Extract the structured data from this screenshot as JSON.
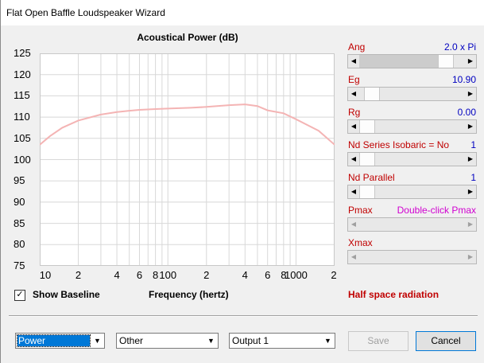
{
  "window": {
    "title": "Flat Open Baffle Loudspeaker Wizard"
  },
  "chart_data": {
    "type": "line",
    "title": "Acoustical Power (dB)",
    "xlabel": "Frequency (hertz)",
    "ylabel": "",
    "x_scale": "log",
    "xlim": [
      10,
      2000
    ],
    "ylim": [
      75,
      125
    ],
    "y_ticks": [
      "125",
      "120",
      "115",
      "110",
      "105",
      "100",
      "95",
      "90",
      "85",
      "80",
      "75"
    ],
    "x_ticks": [
      "10",
      "2",
      "4",
      "6",
      "8",
      "100",
      "2",
      "4",
      "6",
      "8",
      "1000",
      "2"
    ],
    "grid": true,
    "line_color": "#f4b4b4",
    "series": [
      {
        "x": [
          10,
          12,
          15,
          20,
          30,
          40,
          50,
          60,
          80,
          100,
          150,
          200,
          300,
          400,
          500,
          600,
          800,
          1000,
          1500,
          2000
        ],
        "y": [
          103.5,
          105.5,
          107.5,
          109.2,
          110.6,
          111.2,
          111.5,
          111.7,
          111.9,
          112.0,
          112.2,
          112.4,
          112.8,
          113.0,
          112.6,
          111.6,
          110.9,
          109.5,
          106.8,
          103.5
        ]
      }
    ]
  },
  "params": [
    {
      "label": "Ang",
      "value": "2.0 x Pi",
      "level": 0.88,
      "enabled": true
    },
    {
      "label": "Eg",
      "value": "10.90",
      "level": 0.05,
      "enabled": true
    },
    {
      "label": "Rg",
      "value": "0.00",
      "level": 0.0,
      "enabled": true
    },
    {
      "label": "Nd Series   Isobaric = No",
      "value": "1",
      "level": 0.0,
      "enabled": true
    },
    {
      "label": "Nd  Parallel",
      "value": "1",
      "level": 0.0,
      "enabled": true
    },
    {
      "label": "Pmax",
      "value": "Double-click Pmax",
      "level": null,
      "enabled": false
    },
    {
      "label": "Xmax",
      "value": "",
      "level": null,
      "enabled": false
    }
  ],
  "show_baseline": {
    "label": "Show Baseline",
    "checked": true
  },
  "radiation_label": "Half space radiation",
  "combos": [
    {
      "value": "Power"
    },
    {
      "value": "Other"
    },
    {
      "value": "Output 1"
    }
  ],
  "buttons": {
    "save": "Save",
    "cancel": "Cancel"
  },
  "colors": {
    "param_label": "#c00000",
    "param_value": "#0000c0",
    "pmax_hint": "#d000d0"
  }
}
